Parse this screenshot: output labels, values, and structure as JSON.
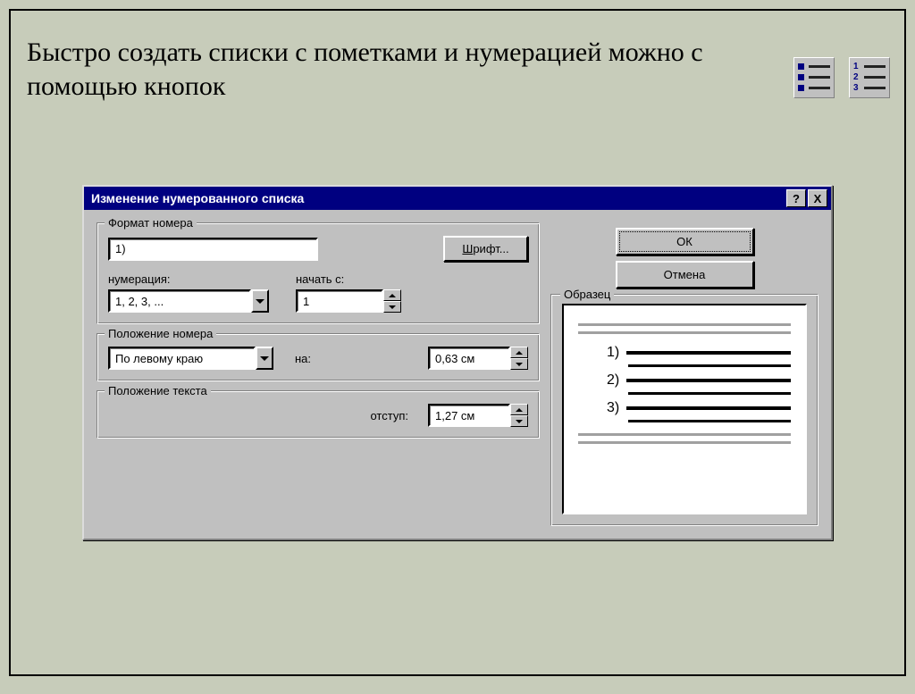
{
  "headline": "Быстро создать списки с пометками и нумерацией можно с помощью кнопок",
  "dialog": {
    "title": "Изменение нумерованного списка",
    "help_btn": "?",
    "close_btn": "X",
    "format_group": {
      "legend": "Формат номера",
      "value": "1)",
      "font_btn_prefix": "Ш",
      "font_btn_rest": "рифт...",
      "numbering_label": "нумерация:",
      "numbering_value": "1, 2, 3, ...",
      "start_label": "начать с:",
      "start_value": "1"
    },
    "number_pos_group": {
      "legend": "Положение номера",
      "align_value": "По левому краю",
      "at_label": "на:",
      "at_value": "0,63 см"
    },
    "text_pos_group": {
      "legend": "Положение текста",
      "indent_label": "отступ:",
      "indent_value": "1,27 см"
    },
    "ok": "ОК",
    "cancel": "Отмена",
    "preview_legend": "Образец",
    "preview_numbers": [
      "1)",
      "2)",
      "3)"
    ]
  }
}
